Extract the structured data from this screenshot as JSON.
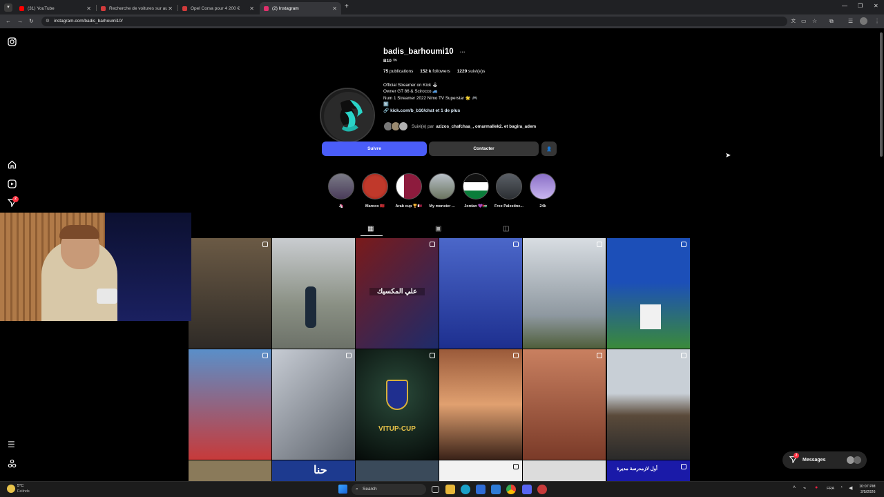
{
  "browser": {
    "tabs": [
      {
        "title": "(31) YouTube",
        "color": "#ff0000"
      },
      {
        "title": "Recherche de voitures sur auto...",
        "color": "#d23b3b"
      },
      {
        "title": "Opel Corsa pour 4 200 €",
        "color": "#d23b3b"
      },
      {
        "title": "(2) Instagram",
        "color": "#e1306c"
      }
    ],
    "url": "instagram.com/badis_barhoumi10/"
  },
  "profile": {
    "username": "badis_barhoumi10",
    "more": "···",
    "full_name": "B10 ᵀᴺ",
    "stats": {
      "posts_count": "75",
      "posts_label": "publications",
      "followers_count": "152 k",
      "followers_label": "followers",
      "following_count": "1229",
      "following_label": "suivi(e)s"
    },
    "bio": [
      "Official Streamer on Kick 🕹",
      "Owner GT 86 & Scirocco 🚙",
      "Num 1 Streamer 2022 Nimo TV Superstar 🌟 🎮",
      "1️⃣"
    ],
    "link": "kick.com/b_b10/chat et 1 de plus",
    "followed_by_prefix": "Suivi(e) par",
    "followed_by_names": "azizos_chafchaa_, omarmallek2. et bagira_adem",
    "follow_button": "Suivre",
    "contact_button": "Contacter"
  },
  "highlights": [
    {
      "label": "🦄"
    },
    {
      "label": "Maroco 🇲🇦"
    },
    {
      "label": "Arab cup 🏆🇶🇦"
    },
    {
      "label": "My monster ..."
    },
    {
      "label": "Jordan 💜🇯🇴"
    },
    {
      "label": "Free Palestine..."
    },
    {
      "label": "24k"
    }
  ],
  "posts": {
    "overlay_texts": [
      "علي المكسيك",
      "VITUP-CUP",
      "حنا",
      "أول لازمدرسة مديرة"
    ]
  },
  "messages": {
    "label": "Messages",
    "badge": "2"
  },
  "notification_badge": "2",
  "taskbar": {
    "weather_temp": "5°C",
    "weather_desc": "Feilnds",
    "search": "Search",
    "lang": "FRA",
    "time": "10:07 PM",
    "date": "2/5/2026"
  }
}
